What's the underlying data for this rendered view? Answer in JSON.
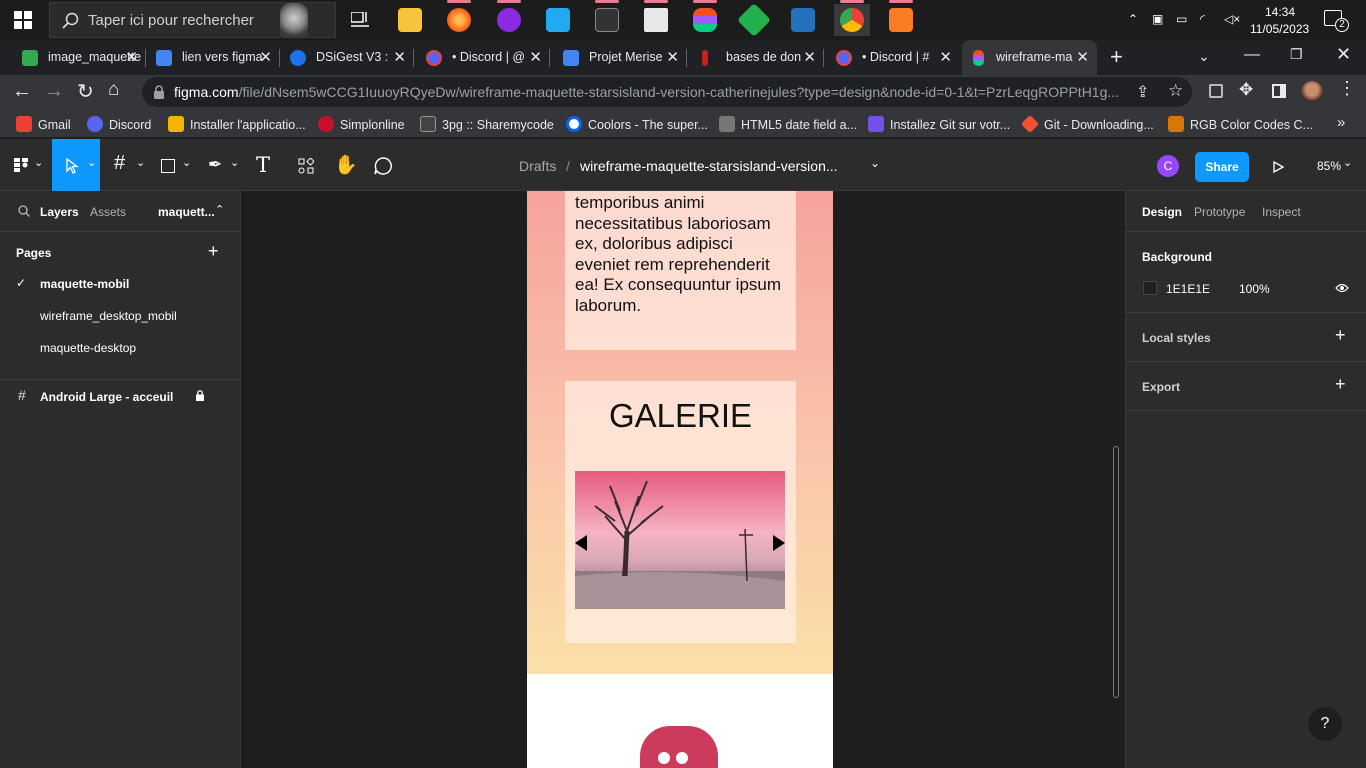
{
  "taskbar": {
    "search_placeholder": "Taper ici pour rechercher",
    "time": "14:34",
    "date": "11/05/2023",
    "notification_count": "2"
  },
  "tabs": [
    {
      "label": "image_maquette",
      "color": "#34a853"
    },
    {
      "label": "lien vers figma",
      "color": "#4285f4"
    },
    {
      "label": "DSiGest V3 :",
      "color": "#1a73e8"
    },
    {
      "label": "• Discord | @",
      "color": "#ea4335"
    },
    {
      "label": "Projet Merise",
      "color": "#4285f4"
    },
    {
      "label": "bases de don",
      "color": "#c5221f"
    },
    {
      "label": "• Discord | #",
      "color": "#ea4335"
    },
    {
      "label": "wireframe-ma",
      "color": "#f24e1e"
    }
  ],
  "address": {
    "url_host": "figma.com",
    "url_rest": "/file/dNsem5wCCG1IuuoyRQyeDw/wireframe-maquette-starsisland-version-catherinejules?type=design&node-id=0-1&t=PzrLeqgROPPtH1g..."
  },
  "bookmarks": [
    {
      "label": "Gmail",
      "color": "#ea4335"
    },
    {
      "label": "Discord",
      "color": "#5865f2"
    },
    {
      "label": "Installer l'applicatio...",
      "color": "#f4b400"
    },
    {
      "label": "Simplonline",
      "color": "#c8102e"
    },
    {
      "label": "3pg :: Sharemycode",
      "color": "#444444"
    },
    {
      "label": "Coolors - The super...",
      "color": "#0066ff"
    },
    {
      "label": "HTML5 date field a...",
      "color": "#777777"
    },
    {
      "label": "Installez Git sur votr...",
      "color": "#7451eb"
    },
    {
      "label": "Git - Downloading...",
      "color": "#f05133"
    },
    {
      "label": "RGB Color Codes C...",
      "color": "#d97706"
    }
  ],
  "figma": {
    "breadcrumb_drafts": "Drafts",
    "breadcrumb_sep": "/",
    "file_name": "wireframe-maquette-starsisland-version...",
    "avatar_letter": "C",
    "share_label": "Share",
    "zoom": "85%",
    "left": {
      "tab_layers": "Layers",
      "tab_assets": "Assets",
      "page_dropdown": "maquett...",
      "pages_heading": "Pages",
      "pages": [
        "maquette-mobil",
        "wireframe_desktop_mobil",
        "maquette-desktop"
      ],
      "layer_name": "Android Large - acceuil"
    },
    "right": {
      "tab_design": "Design",
      "tab_prototype": "Prototype",
      "tab_inspect": "Inspect",
      "background_heading": "Background",
      "bg_hex": "1E1E1E",
      "bg_opacity": "100%",
      "local_styles": "Local styles",
      "export": "Export"
    },
    "canvas": {
      "lorem_text": "temporibus animi necessitatibus laboriosam ex, doloribus adipisci eveniet rem reprehenderit ea! Ex consequuntur ipsum laborum.",
      "gallery_title": "GALERIE"
    },
    "help": "?"
  },
  "colors": {
    "figma_blue": "#0d99ff",
    "avatar_purple": "#9747ff",
    "discord_pink": "#cc3a5c"
  }
}
